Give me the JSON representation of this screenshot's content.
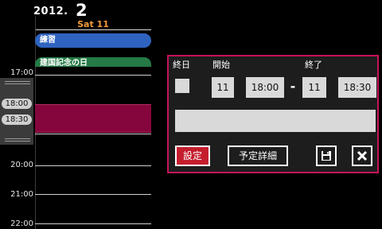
{
  "header": {
    "year": "2012.",
    "month": "2",
    "date_label": "Sat 11"
  },
  "all_day_events": [
    {
      "title": "練習"
    },
    {
      "title": "建国記念の日"
    }
  ],
  "time_labels": [
    "17:00",
    "20:00",
    "21:00",
    "22:00"
  ],
  "selection": {
    "start_label": "18:00",
    "end_label": "18:30"
  },
  "dialog": {
    "all_day_label": "終日",
    "start_label": "開始",
    "end_label": "終了",
    "start_day": "11",
    "start_time": "18:00",
    "range_separator": "-",
    "end_day": "11",
    "end_time": "18:30",
    "title_value": "",
    "settings_button": "設定",
    "details_button": "予定詳細",
    "save_icon": "floppy-disk-icon",
    "close_icon": "close-icon"
  },
  "colors": {
    "accent": "#c4145a",
    "selection": "#84063c",
    "date_label": "#f39a3d",
    "event_blue": "#2f63c0",
    "event_green": "#257a45"
  }
}
